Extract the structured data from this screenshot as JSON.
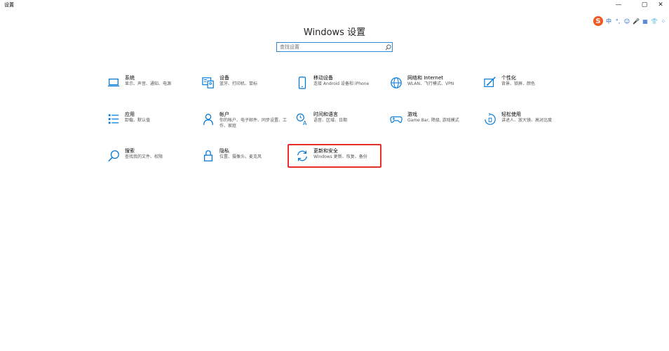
{
  "app": {
    "title": "设置"
  },
  "window_controls": {
    "minimize": "—",
    "maximize": "▢",
    "close": "✕"
  },
  "ime": {
    "logo": "S",
    "items": [
      "中",
      "°,",
      "☺",
      "🎤",
      "▦",
      "👕",
      "⁘"
    ]
  },
  "page": {
    "title": "Windows 设置"
  },
  "search": {
    "placeholder": "查找设置"
  },
  "colors": {
    "accent": "#0078d7",
    "highlight": "#e8302b"
  },
  "categories": [
    {
      "id": "system",
      "icon": "laptop-icon",
      "name": "系统",
      "desc": "显示、声音、通知、电源"
    },
    {
      "id": "devices",
      "icon": "keyboard-icon",
      "name": "设备",
      "desc": "蓝牙、打印机、鼠标"
    },
    {
      "id": "phone",
      "icon": "phone-icon",
      "name": "移动设备",
      "desc": "连接 Android 设备和 iPhone"
    },
    {
      "id": "network",
      "icon": "globe-icon",
      "name": "网络和 Internet",
      "desc": "WLAN、飞行模式、VPN"
    },
    {
      "id": "personalization",
      "icon": "brush-icon",
      "name": "个性化",
      "desc": "背景、锁屏、颜色"
    },
    {
      "id": "apps",
      "icon": "apps-list-icon",
      "name": "应用",
      "desc": "卸载、默认值"
    },
    {
      "id": "accounts",
      "icon": "person-icon",
      "name": "帐户",
      "desc": "你的帐户、电子邮件、同步设置、工作、家庭"
    },
    {
      "id": "time",
      "icon": "time-language-icon",
      "name": "时间和语言",
      "desc": "语音、区域、日期"
    },
    {
      "id": "gaming",
      "icon": "gamepad-icon",
      "name": "游戏",
      "desc": "Game Bar, 降级, 游戏模式"
    },
    {
      "id": "ease",
      "icon": "ease-of-access-icon",
      "name": "轻松使用",
      "desc": "讲述人、放大镜、高对比度"
    },
    {
      "id": "search",
      "icon": "search-icon",
      "name": "搜索",
      "desc": "查找我的文件、权限"
    },
    {
      "id": "privacy",
      "icon": "lock-icon",
      "name": "隐私",
      "desc": "位置、摄像头、麦克风"
    },
    {
      "id": "update",
      "icon": "sync-icon",
      "name": "更新和安全",
      "desc": "Windows 更新、恢复、备份"
    }
  ]
}
